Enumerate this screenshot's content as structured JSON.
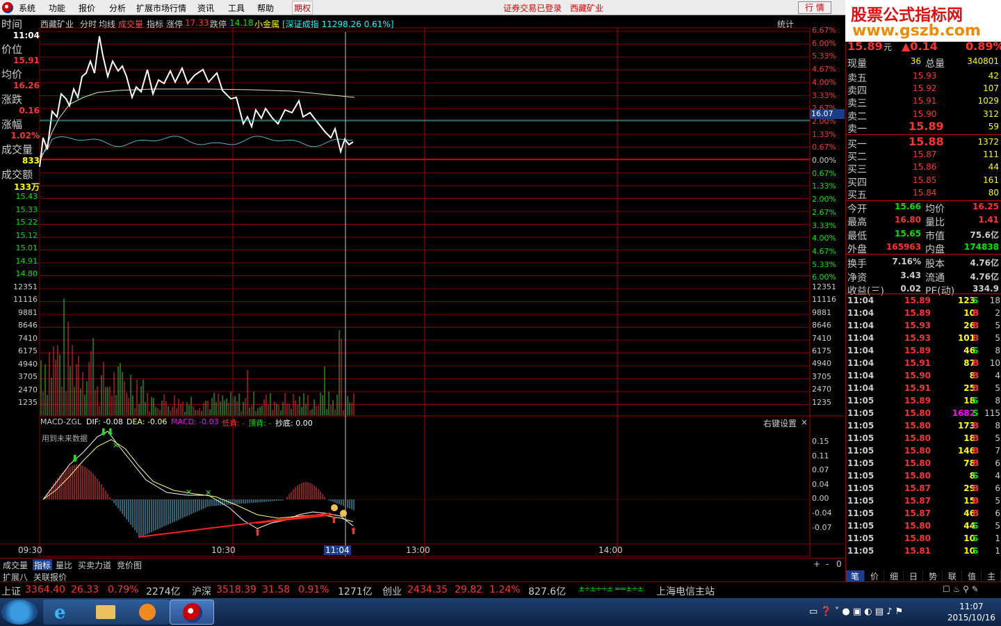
{
  "menu": {
    "items": [
      "系统",
      "功能",
      "报价",
      "分析",
      "扩展市场行情",
      "资讯",
      "工具",
      "帮助"
    ],
    "qiquan": "期权",
    "status": "证券交易已登录",
    "stock": "西藏矿业",
    "hq": "行 情"
  },
  "logo": {
    "line1": "股票公式指标网",
    "line2": "www.gszb.com"
  },
  "header": {
    "name": "西藏矿业",
    "fenshi": "分时",
    "junxian": "均线",
    "chengjiao": "成交量",
    "zhibiao": "指标",
    "zt_label": "涨停",
    "zt": "17.33",
    "dt_label": "跌停",
    "dt": "14.18",
    "group": "小金属",
    "index": "[深证成指 11298.26 0.61%]",
    "tongji": "统计"
  },
  "left": {
    "time_label": "时间",
    "time": "11:04",
    "price_label": "价位",
    "price": "15.91",
    "avg_label": "均价",
    "avg": "16.26",
    "chg_label": "涨跌",
    "chg": "0.16",
    "pct_label": "涨幅",
    "pct": "1.02%",
    "vol_label": "成交量",
    "vol": "833",
    "amt_label": "成交额",
    "amt": "133万"
  },
  "yaxis_left": [
    "15.43",
    "15.33",
    "15.22",
    "15.12",
    "15.01",
    "14.91",
    "14.80",
    "12351",
    "11116",
    "9881",
    "8646",
    "7410",
    "6175",
    "4940",
    "3705",
    "2470",
    "1235"
  ],
  "yaxis_right_pct": [
    "6.67%",
    "6.00%",
    "5.33%",
    "4.67%",
    "4.00%",
    "3.33%",
    "2.67%",
    "2.00%",
    "1.33%",
    "0.67%",
    "0.00%",
    "0.67%",
    "1.33%",
    "2.00%",
    "2.67%",
    "3.33%",
    "4.00%",
    "4.67%",
    "5.33%",
    "6.00%"
  ],
  "yaxis_right_vol": [
    "12351",
    "11116",
    "9881",
    "8646",
    "7410",
    "6175",
    "4940",
    "3705",
    "2470",
    "1235"
  ],
  "cursor_price": "16.07",
  "macd": {
    "name": "MACD-ZGL",
    "dif": "DIF: -0.08",
    "dea": "DEA: -0.06",
    "macd": "MACD: -0.03",
    "low": "低背: -",
    "top": "顶背: -",
    "bottom": "抄底: 0.00",
    "note": "用到未来数据",
    "rset": "右键设置",
    "ticks": [
      "0.15",
      "0.11",
      "0.07",
      "0.04",
      "0.00",
      "-0.04",
      "-0.07"
    ]
  },
  "xaxis": [
    "09:30",
    "10:30",
    "11:04",
    "13:00",
    "14:00"
  ],
  "tabs": [
    "成交量",
    "指标",
    "量比",
    "买卖力道",
    "竞价图"
  ],
  "tabs2": [
    "扩展八",
    "关联报价"
  ],
  "quote": {
    "price": "15.89",
    "unit": "元",
    "chg": "▲0.14",
    "pct": "0.89%",
    "xianliang_label": "现量",
    "xianliang": "36",
    "zongliang_label": "总量",
    "zongliang": "340801",
    "sells": [
      {
        "l": "卖五",
        "p": "15.93",
        "v": "42"
      },
      {
        "l": "卖四",
        "p": "15.92",
        "v": "107"
      },
      {
        "l": "卖三",
        "p": "15.91",
        "v": "1029"
      },
      {
        "l": "卖二",
        "p": "15.90",
        "v": "312"
      },
      {
        "l": "卖一",
        "p": "15.89",
        "v": "59"
      }
    ],
    "buys": [
      {
        "l": "买一",
        "p": "15.88",
        "v": "1372"
      },
      {
        "l": "买二",
        "p": "15.87",
        "v": "111"
      },
      {
        "l": "买三",
        "p": "15.86",
        "v": "44"
      },
      {
        "l": "买四",
        "p": "15.85",
        "v": "161"
      },
      {
        "l": "买五",
        "p": "15.84",
        "v": "80"
      }
    ],
    "stats": [
      [
        "今开",
        "15.66",
        "均价",
        "16.25"
      ],
      [
        "最高",
        "16.80",
        "量比",
        "1.41"
      ],
      [
        "最低",
        "15.65",
        "市值",
        "75.6亿"
      ],
      [
        "外盘",
        "165963",
        "内盘",
        "174838"
      ],
      [
        "换手",
        "7.16%",
        "股本",
        "4.76亿"
      ],
      [
        "净资",
        "3.43",
        "流通",
        "4.76亿"
      ],
      [
        "收益(三)",
        "0.02",
        "PE(动)",
        "334.9"
      ]
    ]
  },
  "ticks": [
    [
      "11:04",
      "15.89",
      "123",
      "S",
      "18"
    ],
    [
      "11:04",
      "15.89",
      "10",
      "B",
      "2"
    ],
    [
      "11:04",
      "15.93",
      "26",
      "B",
      "5"
    ],
    [
      "11:04",
      "15.93",
      "101",
      "B",
      "5"
    ],
    [
      "11:04",
      "15.89",
      "46",
      "S",
      "8"
    ],
    [
      "11:04",
      "15.91",
      "87",
      "B",
      "10"
    ],
    [
      "11:04",
      "15.90",
      "8",
      "B",
      "4"
    ],
    [
      "11:04",
      "15.91",
      "25",
      "B",
      "5"
    ],
    [
      "11:05",
      "15.89",
      "18",
      "S",
      "8"
    ],
    [
      "11:05",
      "15.80",
      "1682",
      "S",
      "115"
    ],
    [
      "11:05",
      "15.80",
      "173",
      "B",
      "8"
    ],
    [
      "11:05",
      "15.80",
      "18",
      "B",
      "5"
    ],
    [
      "11:05",
      "15.80",
      "146",
      "B",
      "7"
    ],
    [
      "11:05",
      "15.80",
      "78",
      "B",
      "6"
    ],
    [
      "11:05",
      "15.80",
      "8",
      "S",
      "4"
    ],
    [
      "11:05",
      "15.87",
      "29",
      "B",
      "6"
    ],
    [
      "11:05",
      "15.87",
      "15",
      "B",
      "5"
    ],
    [
      "11:05",
      "15.87",
      "46",
      "B",
      "6"
    ],
    [
      "11:05",
      "15.80",
      "44",
      "S",
      "5"
    ],
    [
      "11:05",
      "15.80",
      "10",
      "S",
      "1"
    ],
    [
      "11:05",
      "15.81",
      "10",
      "S",
      "1"
    ]
  ],
  "rtabs": [
    "笔",
    "价",
    "细",
    "日",
    "势",
    "联",
    "值",
    "主"
  ],
  "index": [
    {
      "name": "上证",
      "v": "3364.40",
      "c": "26.33",
      "p": "0.79%",
      "a": "2274亿"
    },
    {
      "name": "沪深",
      "v": "3518.39",
      "c": "31.58",
      "p": "0.91%",
      "a": "1271亿"
    },
    {
      "name": "创业",
      "v": "2434.35",
      "c": "29.82",
      "p": "1.24%",
      "a": "827.6亿"
    }
  ],
  "server": "上海电信主站",
  "clock": {
    "time": "11:07",
    "date": "2015/10/16"
  }
}
